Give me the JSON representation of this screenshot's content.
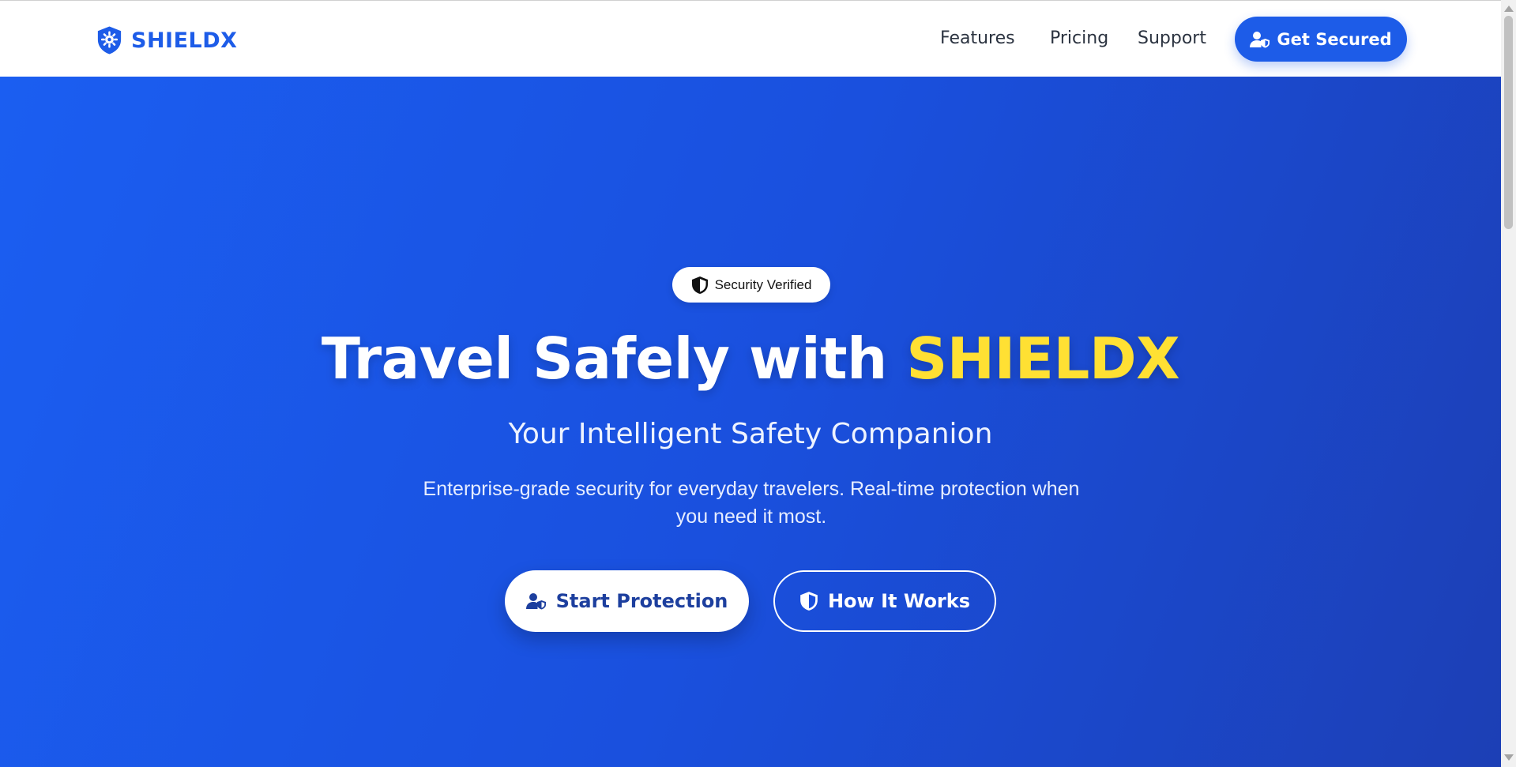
{
  "brand": {
    "name": "SHIELDX",
    "color": "#1d5ce8",
    "icon": "shield-gear-icon"
  },
  "nav": {
    "links": [
      {
        "label": "Features"
      },
      {
        "label": "Pricing"
      },
      {
        "label": "Support"
      }
    ],
    "cta": {
      "label": "Get Secured",
      "icon": "user-shield-icon"
    }
  },
  "hero": {
    "badge": {
      "label": "Security Verified",
      "icon": "shield-half-icon"
    },
    "headline": {
      "prefix": "Travel Safely with ",
      "brand": "SHIELDX"
    },
    "subheadline": "Your Intelligent Safety Companion",
    "description": "Enterprise-grade security for everyday travelers. Real-time protection when you need it most.",
    "buttons": {
      "primary": {
        "label": "Start Protection",
        "icon": "user-shield-icon"
      },
      "secondary": {
        "label": "How It Works",
        "icon": "shield-half-icon"
      }
    }
  },
  "colors": {
    "accent": "#1d5ce8",
    "hero_gradient_start": "#1b5ef1",
    "hero_gradient_end": "#1c3fb5",
    "highlight": "#ffe033"
  }
}
